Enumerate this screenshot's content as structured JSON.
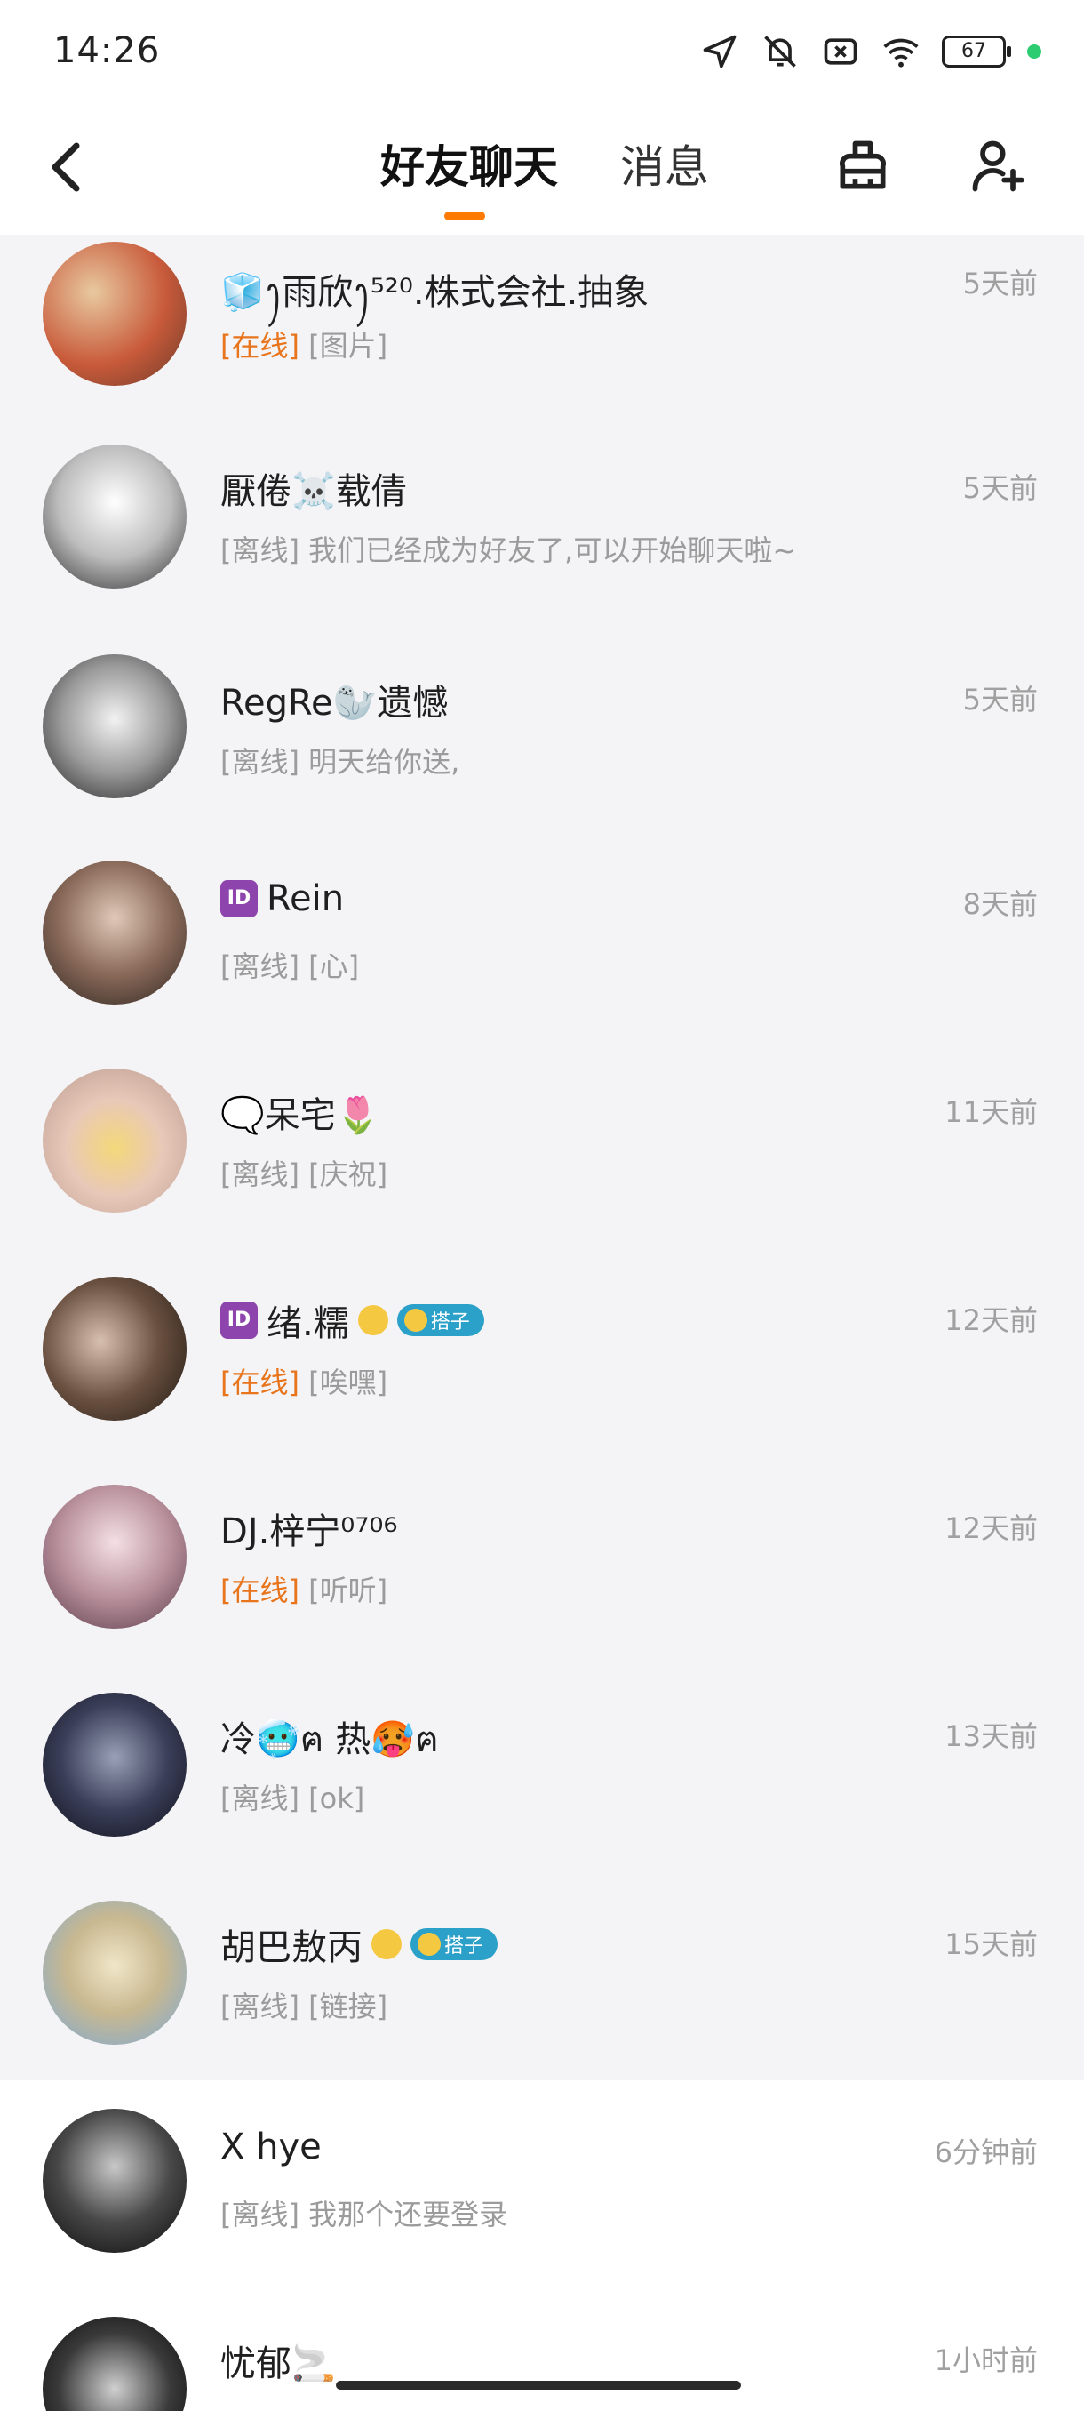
{
  "status_bar": {
    "time": "14:26",
    "battery": "67"
  },
  "header": {
    "tab_friends": "好友聊天",
    "tab_messages": "消息",
    "colors": {
      "accent": "#ff7a00"
    }
  },
  "chats": [
    {
      "name": "🧊ꫂ雨欣ꫂ⁵²⁰.株式会社.抽象",
      "status": "[在线]",
      "message": " [图片]",
      "time": "5天前"
    },
    {
      "name": "厭倦☠️载倩",
      "status": "[离线]",
      "message": " 我们已经成为好友了,可以开始聊天啦~",
      "time": "5天前"
    },
    {
      "name": "RegRe🦭遗憾",
      "status": "[离线]",
      "message": " 明天给你送,",
      "time": "5天前"
    },
    {
      "name": "Rein",
      "status": "[离线]",
      "message": " [心]",
      "time": "8天前"
    },
    {
      "name": "🗨️呆宅🌷",
      "status": "[离线]",
      "message": " [庆祝]",
      "time": "11天前"
    },
    {
      "name": "绪.糯",
      "status": "[在线]",
      "message": " [唉嘿]",
      "time": "12天前",
      "badge": "搭子"
    },
    {
      "name": "DJ.梓宁⁰⁷⁰⁶",
      "status": "[在线]",
      "message": " [听听]",
      "time": "12天前"
    },
    {
      "name": "冷🥶ฅ        热🥵ฅ",
      "status": "[离线]",
      "message": " [ok]",
      "time": "13天前"
    },
    {
      "name": "胡巴敖丙",
      "status": "[离线]",
      "message": " [链接]",
      "time": "15天前",
      "badge": "搭子"
    },
    {
      "name": "X hye",
      "status": "[离线]",
      "message": " 我那个还要登录",
      "time": "6分钟前"
    },
    {
      "name": "忧郁🚬",
      "status": "",
      "message": "",
      "time": "1小时前"
    }
  ]
}
